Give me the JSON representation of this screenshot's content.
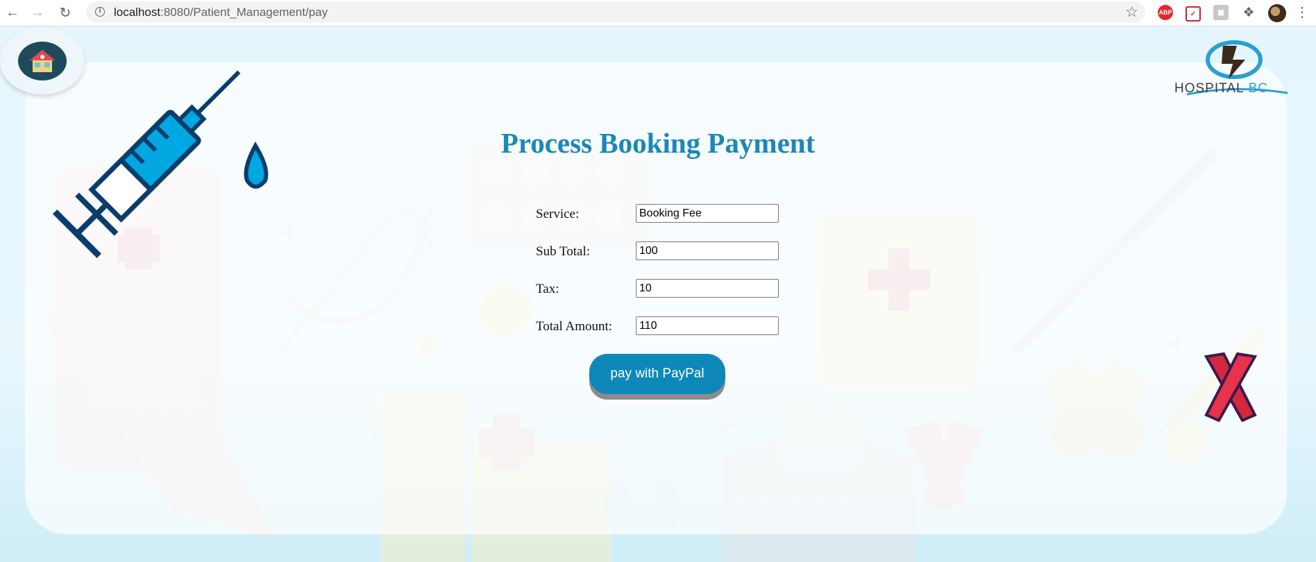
{
  "browser": {
    "url_host": "localhost",
    "url_path": ":8080/Patient_Management/pay",
    "extensions": [
      "ABP",
      "pocket",
      "tampermonkey",
      "puzzle"
    ]
  },
  "page": {
    "title": "Process Booking Payment",
    "logo": {
      "text": "HOSPITAL",
      "suffix": "BC"
    },
    "form": {
      "service_label": "Service:",
      "service_value": "Booking Fee",
      "subtotal_label": "Sub Total:",
      "subtotal_value": "100",
      "tax_label": "Tax:",
      "tax_value": "10",
      "total_label": "Total Amount:",
      "total_value": "110"
    },
    "pay_button_label": "pay with PayPal"
  },
  "colors": {
    "title": "#1a88b8",
    "button": "#0d88b9",
    "background": "#e6f6fd"
  },
  "icons": [
    "back-arrow-icon",
    "forward-arrow-icon",
    "reload-icon",
    "info-icon",
    "star-icon",
    "home-icon",
    "syringe-icon",
    "awareness-ribbon-icon"
  ]
}
